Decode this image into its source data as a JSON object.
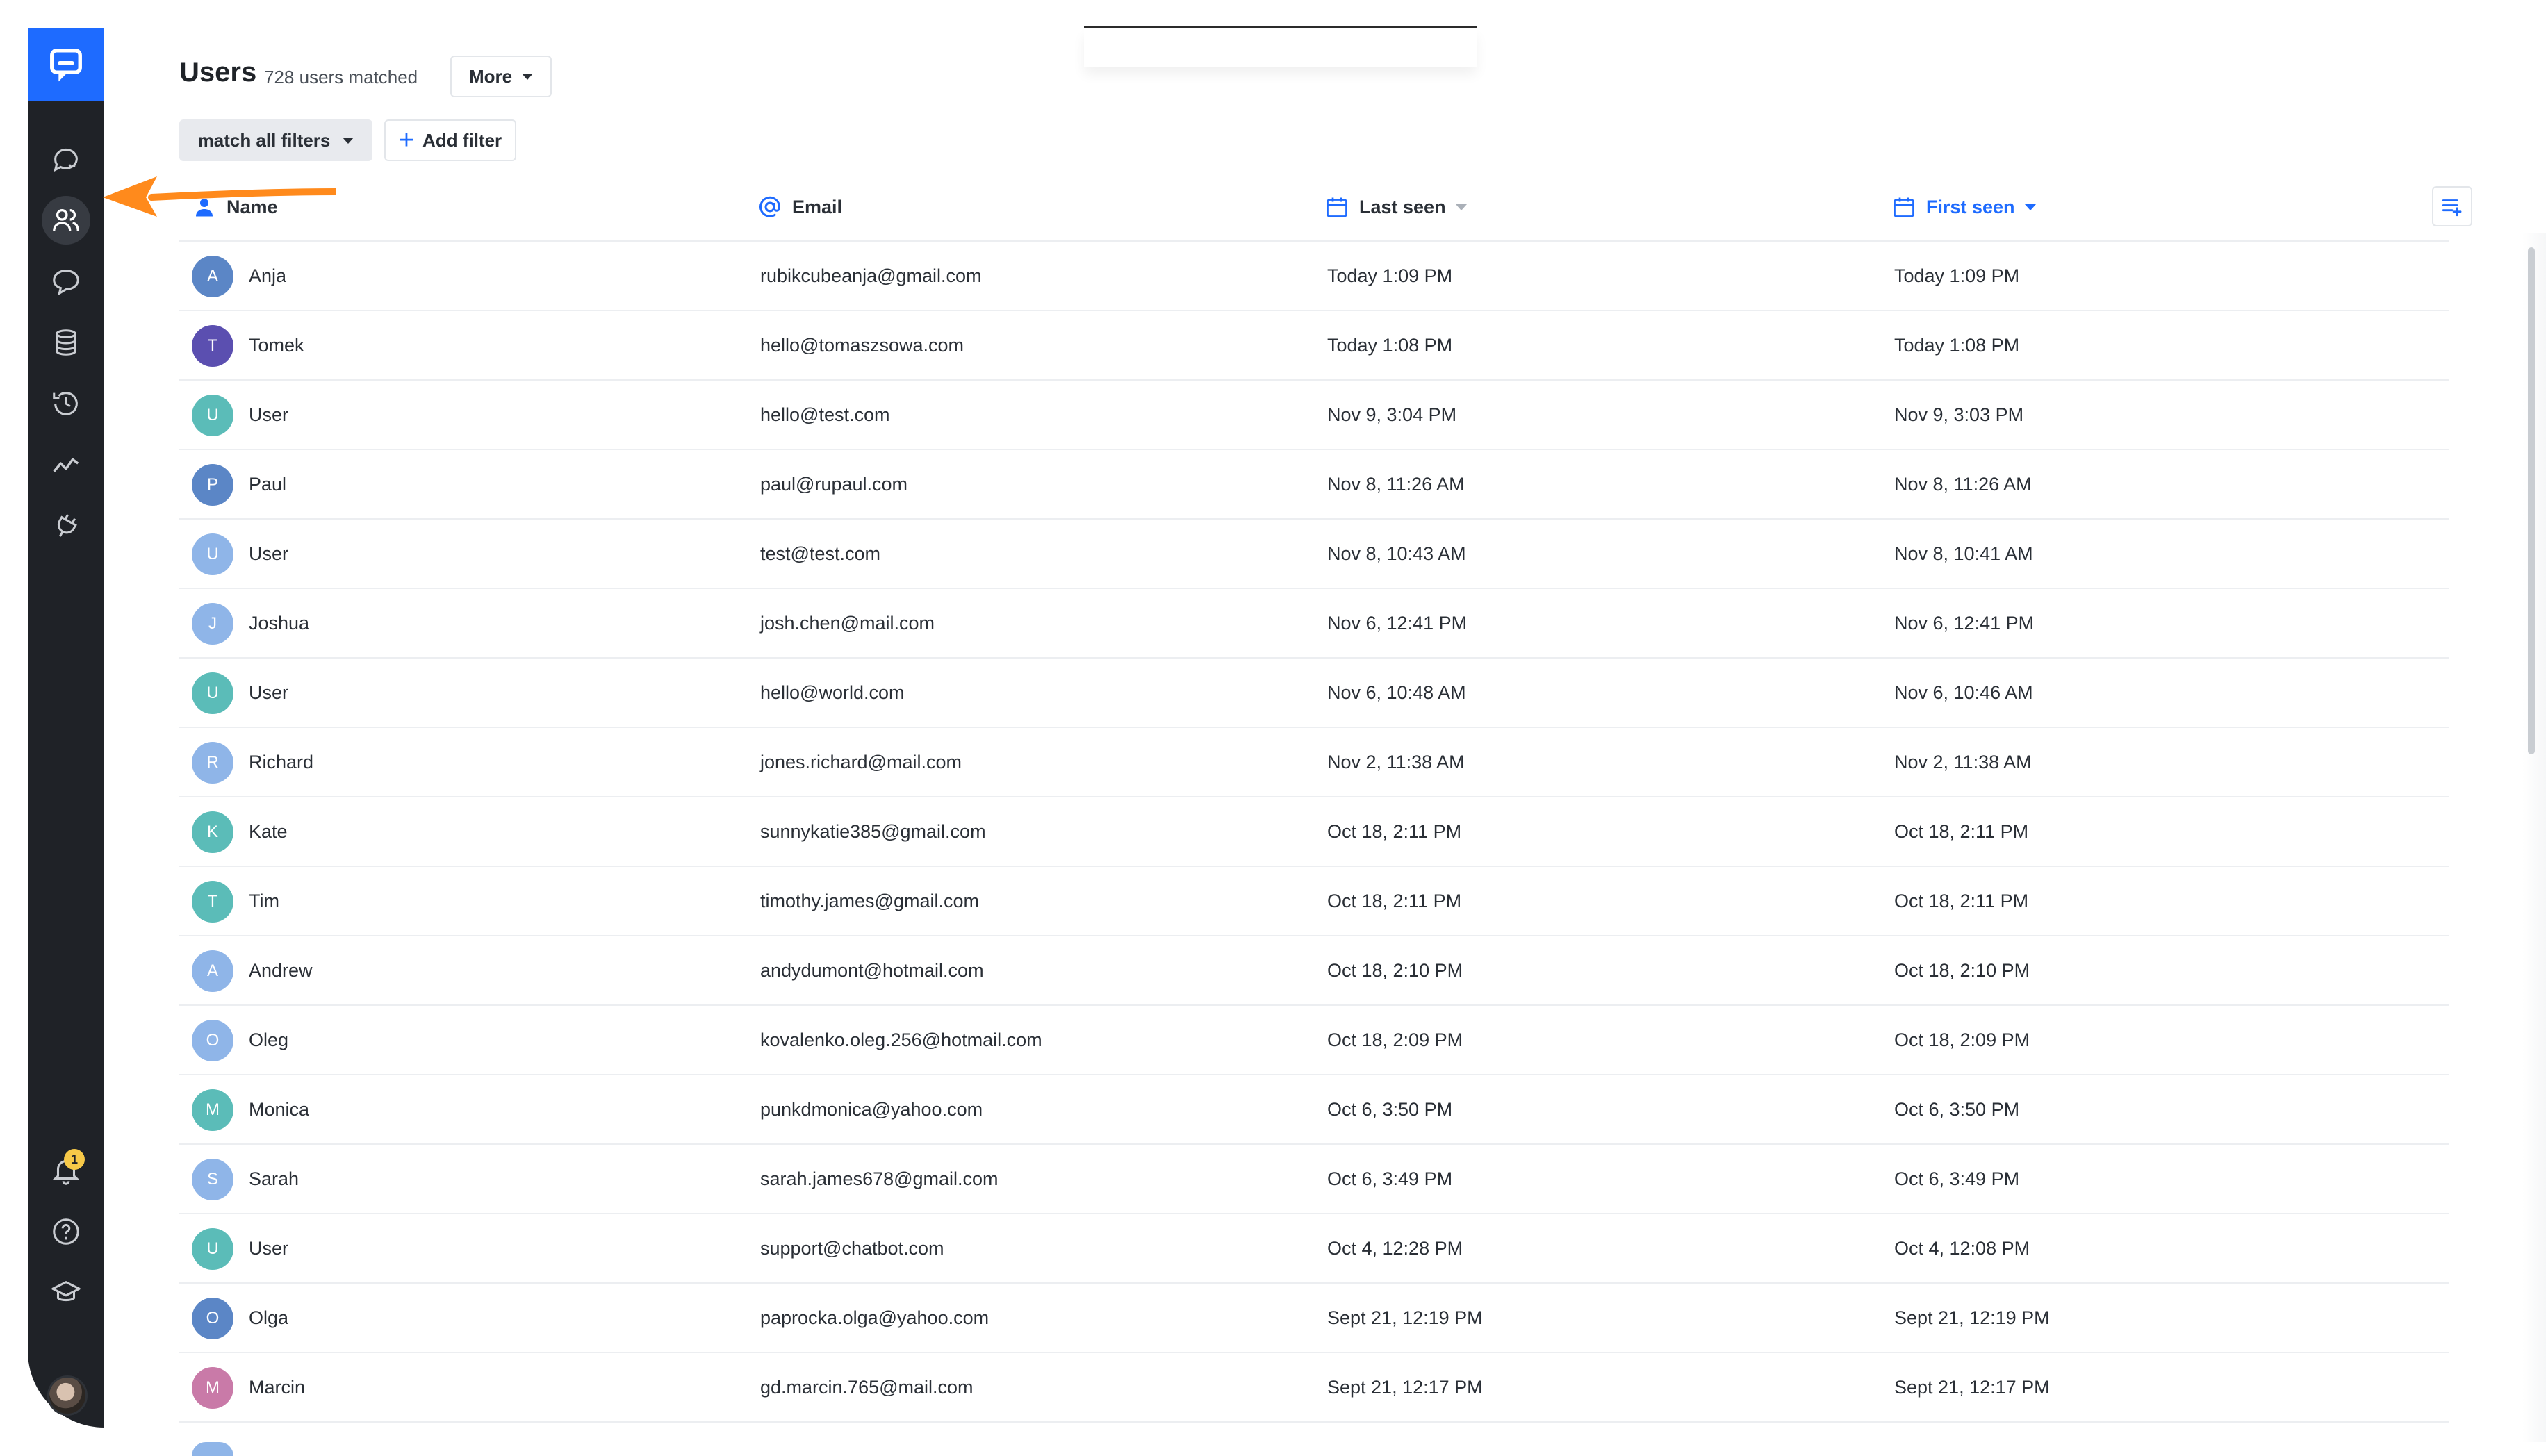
{
  "header": {
    "title": "Users",
    "count": "728 users matched",
    "more_label": "More",
    "filter_label": "match all filters",
    "add_filter_label": "Add filter"
  },
  "sidebar": {
    "notification_count": "1"
  },
  "columns": {
    "name": "Name",
    "email": "Email",
    "last_seen": "Last seen",
    "first_seen": "First seen"
  },
  "colors": {
    "brand": "#1e6bff",
    "sidebar": "#1f2227",
    "annotation_arrow": "#ff8a1c"
  },
  "users": [
    {
      "initial": "A",
      "name": "Anja",
      "email": "rubikcubeanja@gmail.com",
      "last_seen": "Today 1:09 PM",
      "first_seen": "Today 1:09 PM",
      "color": "#5b86c6"
    },
    {
      "initial": "T",
      "name": "Tomek",
      "email": "hello@tomaszsowa.com",
      "last_seen": "Today 1:08 PM",
      "first_seen": "Today 1:08 PM",
      "color": "#5b4fb0"
    },
    {
      "initial": "U",
      "name": "User",
      "email": "hello@test.com",
      "last_seen": "Nov 9, 3:04 PM",
      "first_seen": "Nov 9, 3:03 PM",
      "color": "#5bbcb8"
    },
    {
      "initial": "P",
      "name": "Paul",
      "email": "paul@rupaul.com",
      "last_seen": "Nov 8, 11:26 AM",
      "first_seen": "Nov 8, 11:26 AM",
      "color": "#5b86c6"
    },
    {
      "initial": "U",
      "name": "User",
      "email": "test@test.com",
      "last_seen": "Nov 8, 10:43 AM",
      "first_seen": "Nov 8, 10:41 AM",
      "color": "#8fb5e8"
    },
    {
      "initial": "J",
      "name": "Joshua",
      "email": "josh.chen@mail.com",
      "last_seen": "Nov 6, 12:41 PM",
      "first_seen": "Nov 6, 12:41 PM",
      "color": "#8fb5e8"
    },
    {
      "initial": "U",
      "name": "User",
      "email": "hello@world.com",
      "last_seen": "Nov 6, 10:48 AM",
      "first_seen": "Nov 6, 10:46 AM",
      "color": "#5bbcb8"
    },
    {
      "initial": "R",
      "name": "Richard",
      "email": "jones.richard@mail.com",
      "last_seen": "Nov 2, 11:38 AM",
      "first_seen": "Nov 2, 11:38 AM",
      "color": "#8fb5e8"
    },
    {
      "initial": "K",
      "name": "Kate",
      "email": "sunnykatie385@gmail.com",
      "last_seen": "Oct 18, 2:11 PM",
      "first_seen": "Oct 18, 2:11 PM",
      "color": "#5bbcb8"
    },
    {
      "initial": "T",
      "name": "Tim",
      "email": "timothy.james@gmail.com",
      "last_seen": "Oct 18, 2:11 PM",
      "first_seen": "Oct 18, 2:11 PM",
      "color": "#5bbcb8"
    },
    {
      "initial": "A",
      "name": "Andrew",
      "email": "andydumont@hotmail.com",
      "last_seen": "Oct 18, 2:10 PM",
      "first_seen": "Oct 18, 2:10 PM",
      "color": "#8fb5e8"
    },
    {
      "initial": "O",
      "name": "Oleg",
      "email": "kovalenko.oleg.256@hotmail.com",
      "last_seen": "Oct 18, 2:09 PM",
      "first_seen": "Oct 18, 2:09 PM",
      "color": "#8fb5e8"
    },
    {
      "initial": "M",
      "name": "Monica",
      "email": "punkdmonica@yahoo.com",
      "last_seen": "Oct 6, 3:50 PM",
      "first_seen": "Oct 6, 3:50 PM",
      "color": "#5bbcb8"
    },
    {
      "initial": "S",
      "name": "Sarah",
      "email": "sarah.james678@gmail.com",
      "last_seen": "Oct 6, 3:49 PM",
      "first_seen": "Oct 6, 3:49 PM",
      "color": "#8fb5e8"
    },
    {
      "initial": "U",
      "name": "User",
      "email": "support@chatbot.com",
      "last_seen": "Oct 4, 12:28 PM",
      "first_seen": "Oct 4, 12:08 PM",
      "color": "#5bbcb8"
    },
    {
      "initial": "O",
      "name": "Olga",
      "email": "paprocka.olga@yahoo.com",
      "last_seen": "Sept 21, 12:19 PM",
      "first_seen": "Sept 21, 12:19 PM",
      "color": "#5b86c6"
    },
    {
      "initial": "M",
      "name": "Marcin",
      "email": "gd.marcin.765@mail.com",
      "last_seen": "Sept 21, 12:17 PM",
      "first_seen": "Sept 21, 12:17 PM",
      "color": "#c97aa8"
    }
  ]
}
